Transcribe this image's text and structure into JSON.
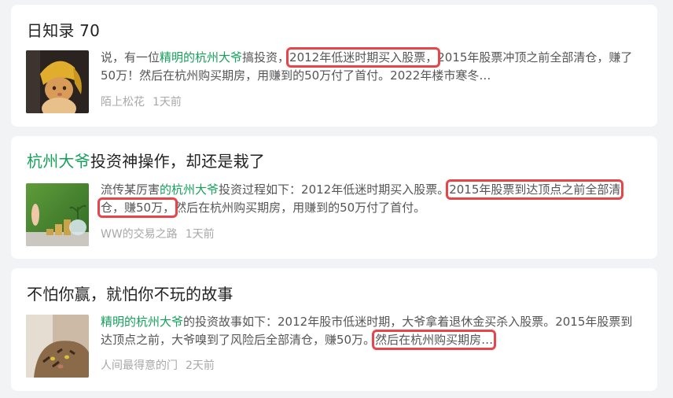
{
  "cards": [
    {
      "title": "日知录 70",
      "snippet_pre": "说，有一位",
      "snippet_hl": "精明的杭州大爷",
      "snippet_mid": "搞投资，",
      "snippet_mark": "2012年低迷时期买入股票，",
      "snippet_post": "2015年股票冲顶之前全部清仓，赚了50万！然后在杭州购买期房，用赚到的50万付了首付。2022年楼市寒冬…",
      "author": "陌上松花",
      "time": "1天前",
      "highlight_color": "#15a15a",
      "box_color": "#e8454a"
    },
    {
      "title_hl": "杭州大爷",
      "title_rest": "投资神操作，却还是栽了",
      "snippet_pre": "流传某厉害",
      "snippet_hl": "的杭州大爷",
      "snippet_mid": "投资过程如下：2012年低迷时期买入股票。",
      "snippet_mark": "2015年股票到达顶点之前全部清仓，赚50万，",
      "snippet_post": "然后在杭州购买期房，用赚到的50万付了首付。",
      "author": "WW的交易之路",
      "time": "1天前"
    },
    {
      "title": "不怕你赢，就怕你不玩的故事",
      "snippet_hl": "精明的杭州大爷",
      "snippet_mid": "的投资故事如下：2012年股市低迷时期，大爷拿着退休金买杀入股票。2015年股票到达顶点之前，大爷嗅到了风险后全部清仓，赚50万。",
      "snippet_mark": "然后在杭州购买期房…",
      "author": "人间最得意的门",
      "time": "2天前"
    }
  ]
}
